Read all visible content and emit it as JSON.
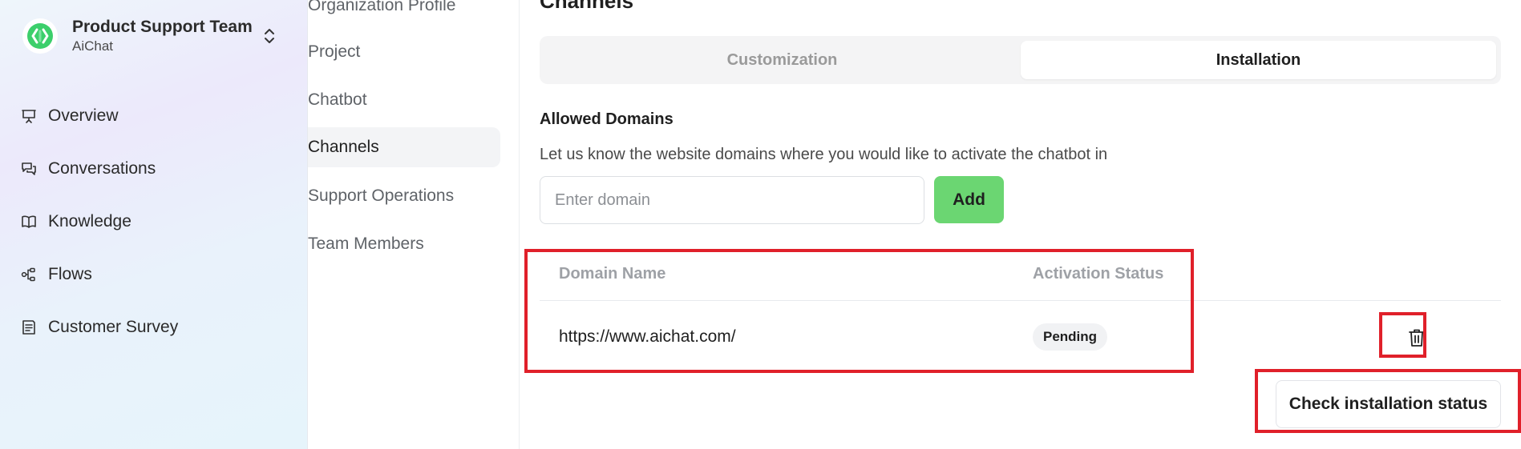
{
  "sidebar": {
    "team_name": "Product Support Team",
    "team_sub": "AiChat",
    "items": [
      {
        "label": "Overview",
        "icon": "presentation-icon"
      },
      {
        "label": "Conversations",
        "icon": "chat-bubbles-icon"
      },
      {
        "label": "Knowledge",
        "icon": "book-icon"
      },
      {
        "label": "Flows",
        "icon": "flow-icon"
      },
      {
        "label": "Customer Survey",
        "icon": "survey-icon"
      }
    ]
  },
  "submenu": {
    "items": [
      {
        "label": "Organization Profile"
      },
      {
        "label": "Project"
      },
      {
        "label": "Chatbot"
      },
      {
        "label": "Channels",
        "active": true
      },
      {
        "label": "Support Operations"
      },
      {
        "label": "Team Members"
      }
    ]
  },
  "main": {
    "title": "Channels",
    "tabs": [
      {
        "label": "Customization",
        "active": false
      },
      {
        "label": "Installation",
        "active": true
      }
    ],
    "allowed_domains": {
      "title": "Allowed Domains",
      "description": "Let us know the website domains where you would like to activate the chatbot in",
      "input_placeholder": "Enter domain",
      "input_value": "",
      "add_label": "Add"
    },
    "table": {
      "columns": [
        "Domain Name",
        "Activation Status"
      ],
      "rows": [
        {
          "domain": "https://www.aichat.com/",
          "status": "Pending"
        }
      ]
    },
    "check_button_label": "Check installation status"
  },
  "colors": {
    "accent_green": "#6bd672",
    "highlight_red": "#e0202a",
    "logo_green": "#3ccf6b"
  }
}
